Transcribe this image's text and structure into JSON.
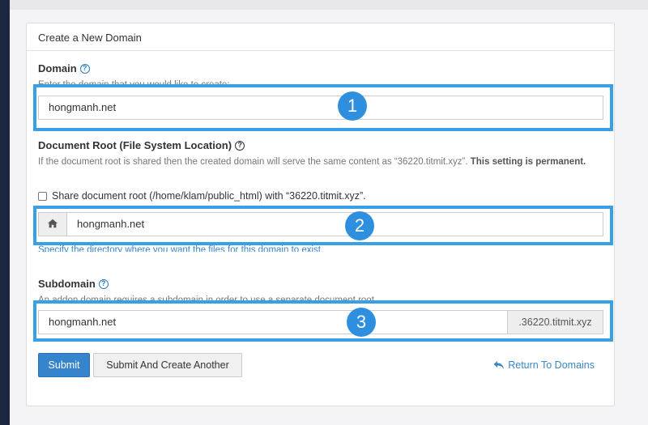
{
  "panel": {
    "title": "Create a New Domain"
  },
  "domain": {
    "label": "Domain",
    "description": "Enter the domain that you would like to create:",
    "value": "hongmanh.net",
    "badge": "1"
  },
  "docroot": {
    "label": "Document Root (File System Location)",
    "description_prefix": "If the document root is shared then the created domain will serve the same content as “36220.titmit.xyz”. ",
    "description_bold": "This setting is permanent.",
    "share_label": "Share document root (/home/klam/public_html) with “36220.titmit.xyz”.",
    "value": "hongmanh.net",
    "hint": "Specify the directory where you want the files for this domain to exist.",
    "badge": "2"
  },
  "subdomain": {
    "label": "Subdomain",
    "description": "An addon domain requires a subdomain in order to use a separate document root.",
    "value": "hongmanh.net",
    "suffix": ".36220.titmit.xyz",
    "badge": "3"
  },
  "actions": {
    "submit_label": "Submit",
    "submit_another_label": "Submit And Create Another",
    "return_label": "Return To Domains"
  },
  "colors": {
    "accent": "#3685cc",
    "highlight": "#3aa0e4",
    "badge": "#2f8fdf"
  }
}
